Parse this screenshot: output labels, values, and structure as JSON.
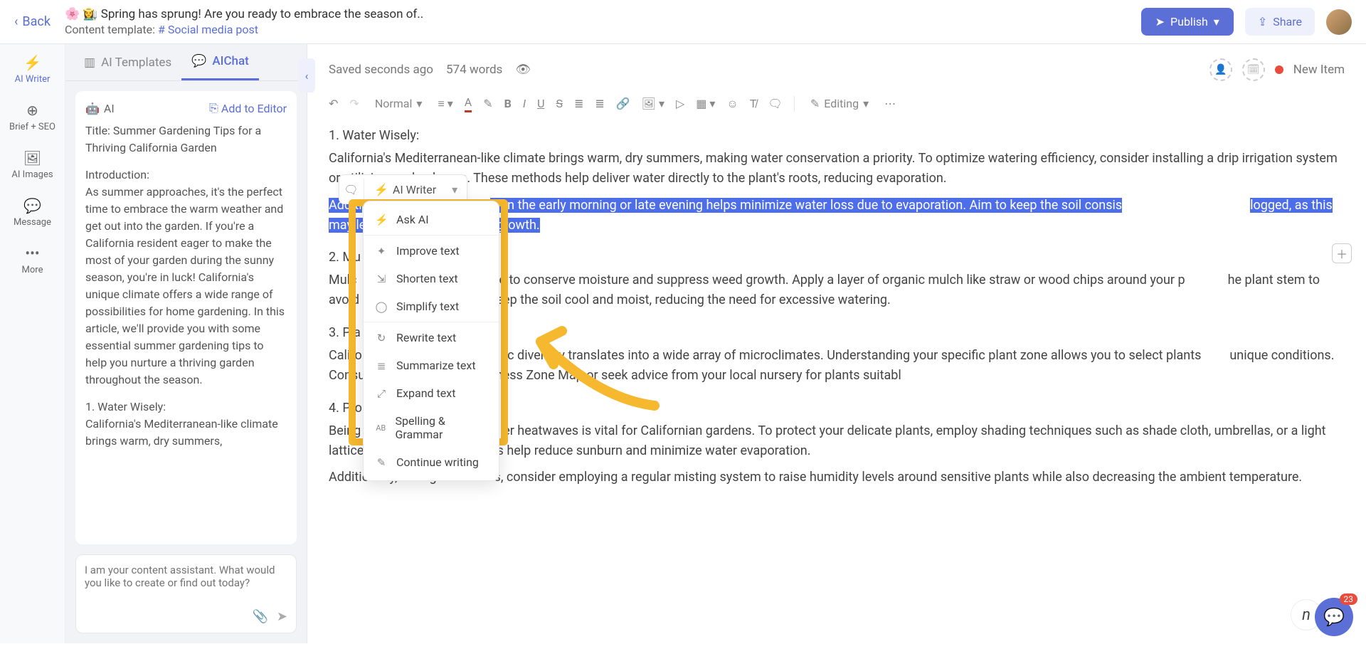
{
  "header": {
    "back": "Back",
    "title": "🌸 👩‍🌾 Spring has sprung! Are you ready to embrace the season of..",
    "template_label": "Content template:",
    "template_value": "# Social media post",
    "publish": "Publish",
    "share": "Share"
  },
  "rail": {
    "ai_writer": "AI Writer",
    "brief_seo": "Brief + SEO",
    "ai_images": "AI Images",
    "message": "Message",
    "more": "More"
  },
  "sidebar": {
    "tabs": {
      "templates": "AI Templates",
      "chat": "AIChat"
    },
    "ai_label": "AI",
    "add_to_editor": "Add to Editor",
    "title_line": "Title: Summer Gardening Tips for a Thriving California Garden",
    "intro_label": "Introduction:",
    "intro_body": "As summer approaches, it's the perfect time to embrace the warm weather and get out into the garden. If you're a California resident eager to make the most of your garden during the sunny season, you're in luck! California's unique climate offers a wide range of possibilities for home gardening. In this article, we'll provide you with some essential summer gardening tips to help you nurture a thriving garden throughout the season.",
    "sec1_label": "1. Water Wisely:",
    "sec1_body": "California's Mediterranean-like climate brings warm, dry summers,",
    "assistant_placeholder": "I am your content assistant. What would you like to create or find out today?"
  },
  "editor": {
    "saved": "Saved seconds ago",
    "word_count": "574 words",
    "new_item": "New Item",
    "style_select": "Normal",
    "mode": "Editing",
    "sec1_h": "1. Water Wisely:",
    "sec1_p1a": "California's Mediterranean-like climate brings warm, dry summers, making water conservation a priority. To optimize watering efficiency, consider installing a drip irrigation system or ",
    "sec1_p1_ul": "utilizing",
    "sec1_p1b": " soaker hoses. These methods help deliver water directly to the plant's roots, reducing evaporation.",
    "sec1_p2a": "Additi",
    "sec1_p2b": "er",
    "sec1_p2c": " in the early morning or late evening helps minimize water loss due to evaporation. Aim to keep the soil consis",
    "sec1_p2d": "logged, as this may lead to root rot or fungal growth.",
    "sec2_h": "2. Mu",
    "sec2_pa": "Mulc",
    "sec2_pb": "e to conserve moisture and suppress weed growth. Apply a layer of organic mulch like straw or wood chips around your p",
    "sec2_pc": "he plant stem to avoid rot. Mulching will help keep the soil cool and moist, reducing the need for excessive watering.",
    "sec3_h": "3. Pla",
    "sec3_pa": "Califo",
    "sec3_pb": "ic diversity translates into a wide array of microclimates. Understanding your specific plant zone allows you to select plants",
    "sec3_pc": "unique conditions. Consult the USDA Plant Hardiness Zone Map or seek advice from your local nursery for plants suitabl",
    "sec4_h": "4. Pro",
    "sec4_pa": "Being",
    "sec4_pb": "er heatwaves is vital for Californian gardens. To protect your delicate plants, employ shading techniques such as shade cloth, umbrellas, or a light lattice frame. Shade structures help reduce sunburn and minimize water evaporation.",
    "sec4_p2": "Additionally, during heatwaves, consider employing a regular misting system to raise humidity levels around sensitive plants while also decreasing the ambient temperature."
  },
  "ai_pill": {
    "label": "AI Writer"
  },
  "dropdown": {
    "items": [
      "Ask AI",
      "Improve text",
      "Shorten text",
      "Simplify text",
      "Rewrite text",
      "Summarize text",
      "Expand text",
      "Spelling & Grammar",
      "Continue writing"
    ]
  },
  "widget": {
    "badge": "23",
    "n": "n"
  }
}
